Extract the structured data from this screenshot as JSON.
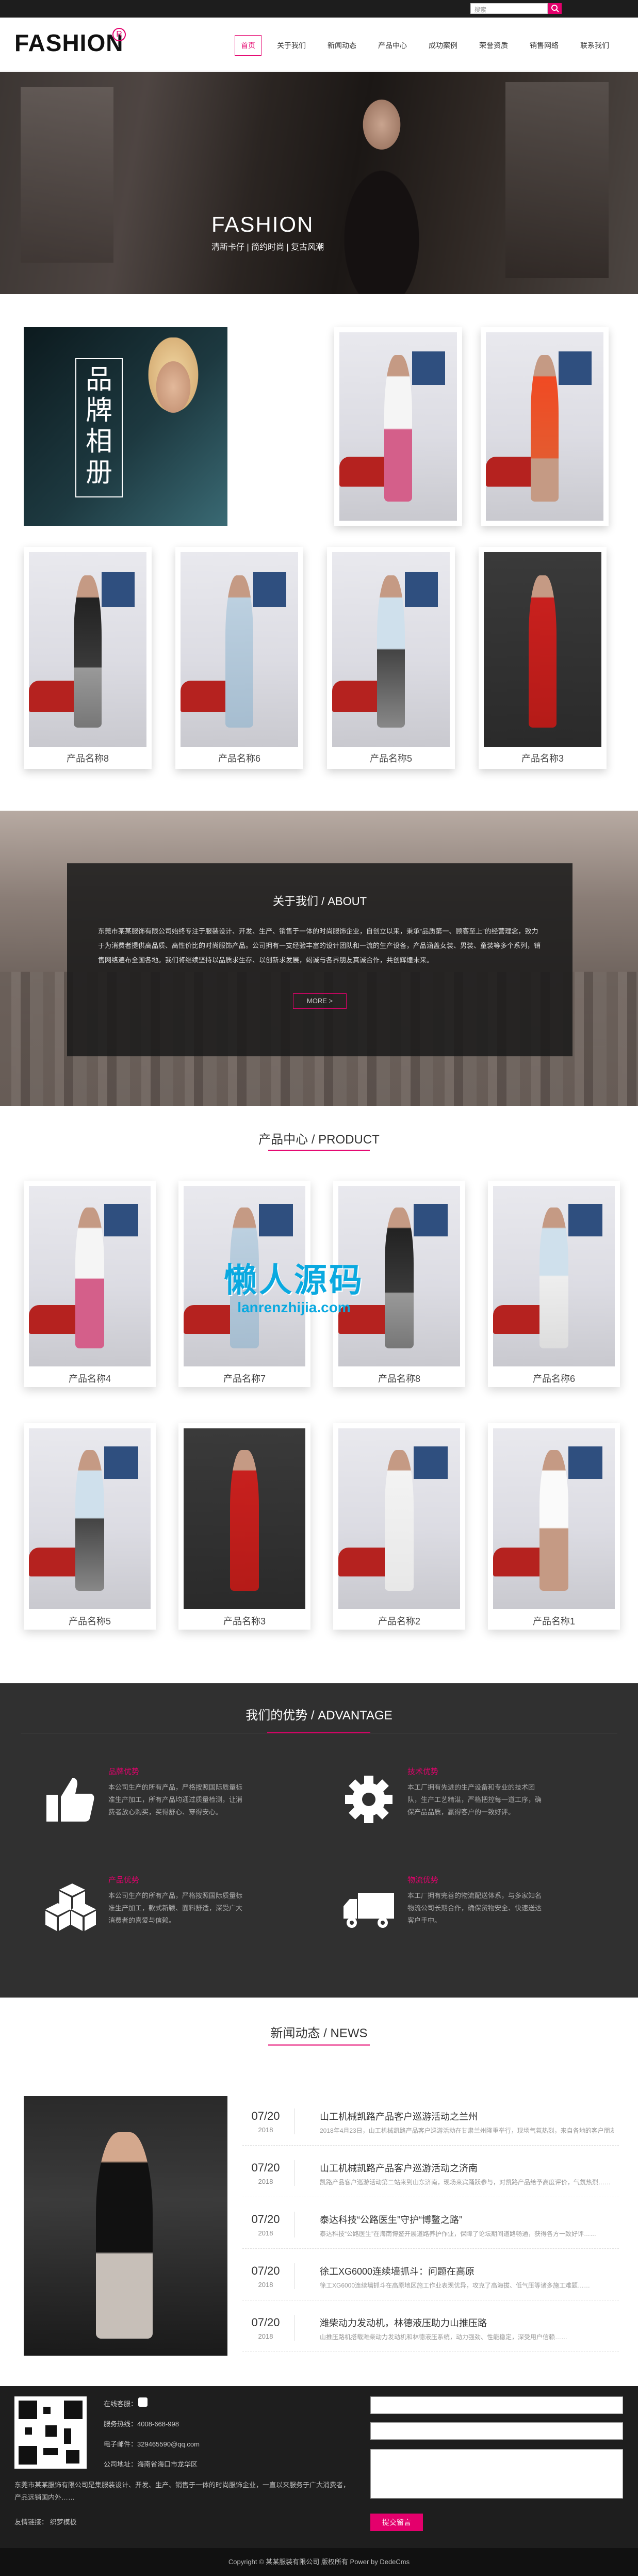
{
  "search": {
    "placeholder": "搜索"
  },
  "logo": {
    "text": "FASHION",
    "mark": "R"
  },
  "nav": [
    "首页",
    "关于我们",
    "新闻动态",
    "产品中心",
    "成功案例",
    "荣誉资质",
    "销售网络",
    "联系我们"
  ],
  "banner": {
    "title": "FASHION",
    "subtitle": "清新卡仔 | 简约时尚 | 复古风潮"
  },
  "album": {
    "brand_label": "品牌相册",
    "top_items": [
      "",
      ""
    ],
    "row_captions": [
      "产品名称8",
      "产品名称6",
      "产品名称5",
      "产品名称3"
    ]
  },
  "about": {
    "title": "关于我们 / ABOUT",
    "text": "东莞市某某服饰有限公司始终专注于服装设计、开发、生产、销售于一体的时尚服饰企业，自创立以来，秉承“品质第一、顾客至上”的经营理念，致力于为消费者提供高品质、高性价比的时尚服饰产品。公司拥有一支经验丰富的设计团队和一流的生产设备，产品涵盖女装、男装、童装等多个系列，销售网络遍布全国各地。我们将继续坚持以品质求生存、以创新求发展，竭诚与各界朋友真诚合作，共创辉煌未来。",
    "more": "MORE >"
  },
  "product": {
    "title": "产品中心 / PRODUCT",
    "captions": [
      "产品名称4",
      "产品名称7",
      "产品名称8",
      "产品名称6",
      "产品名称5",
      "产品名称3",
      "产品名称2",
      "产品名称1"
    ],
    "watermark": "懒人源码",
    "watermark_url": "lanrenzhijia.com"
  },
  "advantage": {
    "title": "我们的优势 / ADVANTAGE",
    "items": [
      {
        "head": "品牌优势",
        "desc": "本公司生产的所有产品，严格按照国际质量标准生产加工，所有产品均通过质量检测，让消费者放心购买，买得舒心、穿得安心。",
        "icon": "thumbs-up-icon"
      },
      {
        "head": "技术优势",
        "desc": "本工厂拥有先进的生产设备和专业的技术团队，生产工艺精湛，严格把控每一道工序，确保产品品质，赢得客户的一致好评。",
        "icon": "gear-icon"
      },
      {
        "head": "产品优势",
        "desc": "本公司生产的所有产品，严格按照国际质量标准生产加工，款式新颖、面料舒适，深受广大消费者的喜爱与信赖。",
        "icon": "boxes-icon"
      },
      {
        "head": "物流优势",
        "desc": "本工厂拥有完善的物流配送体系，与多家知名物流公司长期合作，确保货物安全、快速送达客户手中。",
        "icon": "truck-icon"
      }
    ]
  },
  "news": {
    "title": "新闻动态 / NEWS",
    "items": [
      {
        "date": "07/20",
        "year": "2018",
        "title": "山工机械凯路产品客户巡游活动之兰州",
        "desc": "2018年4月23日，山工机械凯路产品客户巡游活动在甘肃兰州隆重举行，现场气氛热烈，来自各地的客户朋友齐聚一堂……"
      },
      {
        "date": "07/20",
        "year": "2018",
        "title": "山工机械凯路产品客户巡游活动之济南",
        "desc": "凯路产品客户巡游活动第二站来到山东济南，现场来宾踊跃参与，对凯路产品给予高度评价，气氛热烈……"
      },
      {
        "date": "07/20",
        "year": "2018",
        "title": "泰达科技“公路医生”守护“博鳌之路”",
        "desc": "泰达科技“公路医生”在海南博鳌开展道路养护作业，保障了论坛期间道路畅通，获得各方一致好评……"
      },
      {
        "date": "07/20",
        "year": "2018",
        "title": "徐工XG6000连续墙抓斗：问题在高原",
        "desc": "徐工XG6000连续墙抓斗在高原地区施工作业表现优异，攻克了高海拔、低气压等诸多施工难题……"
      },
      {
        "date": "07/20",
        "year": "2018",
        "title": "潍柴动力发动机，林德液压助力山推压路",
        "desc": "山推压路机搭载潍柴动力发动机和林德液压系统，动力强劲、性能稳定，深受用户信赖……"
      }
    ]
  },
  "footer": {
    "online_label": "在线客服：",
    "phone": "服务热线：4008-668-998",
    "email": "电子邮件：329465590@qq.com",
    "address": "公司地址：海南省海口市龙华区",
    "desc": "东莞市某某服饰有限公司是集服装设计、开发、生产、销售于一体的时尚服饰企业，一直以来服务于广大消费者，产品远销国内外……",
    "links": "友情链接： 织梦模板",
    "submit": "提交留言"
  },
  "copyright": "Copyright © 某某服装有限公司 版权所有 Power by DedeCms",
  "colors": {
    "accent": "#e4006c",
    "dark": "#303030",
    "footer": "#1e1e1e"
  }
}
